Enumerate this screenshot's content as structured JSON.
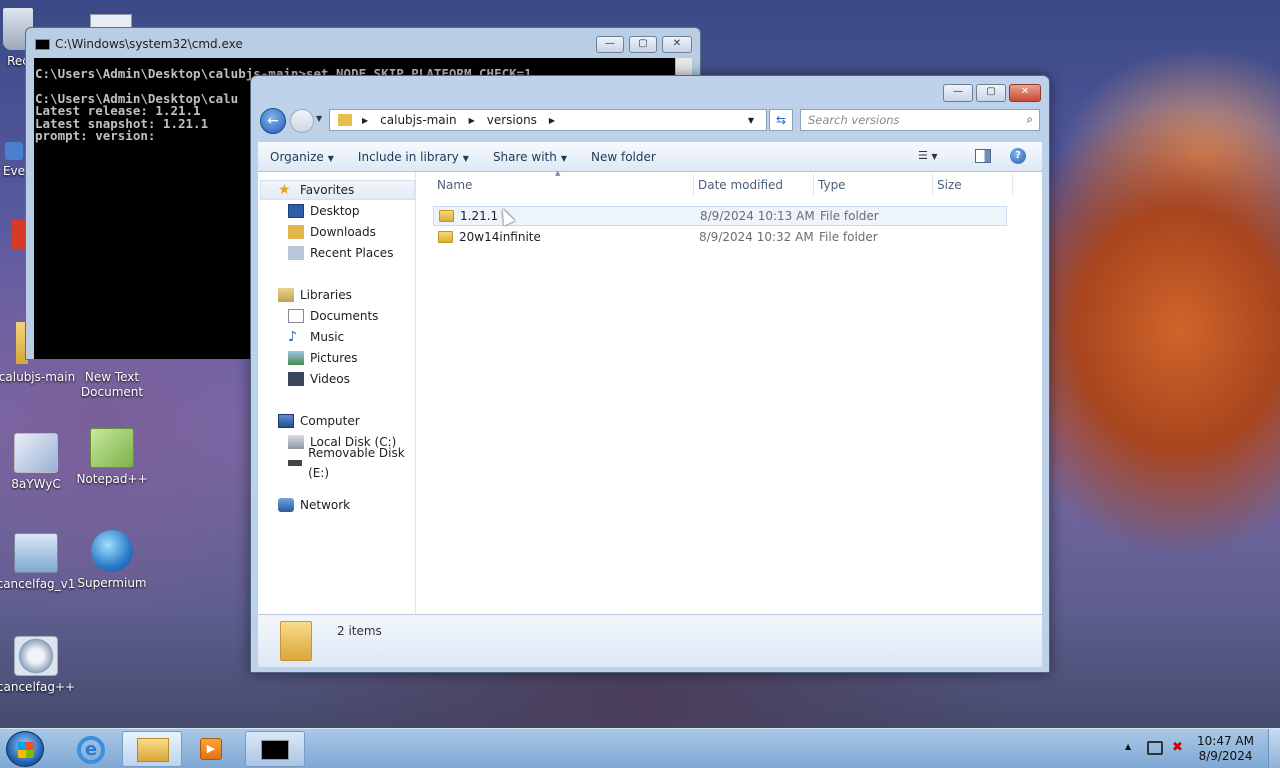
{
  "desktop": {
    "icons": [
      {
        "label": "Rec"
      },
      {
        "label": "Eve"
      },
      {
        "label": "calubjs-main"
      },
      {
        "label": "New Text Document"
      },
      {
        "label": "8aYWyC"
      },
      {
        "label": "Notepad++"
      },
      {
        "label": "cancelfag_v1"
      },
      {
        "label": "Supermium"
      },
      {
        "label": "cancelfag++"
      }
    ]
  },
  "cmd": {
    "title": "C:\\Windows\\system32\\cmd.exe",
    "lines": [
      "C:\\Users\\Admin\\Desktop\\calubjs-main>set NODE_SKIP_PLATFORM_CHECK=1",
      "",
      "C:\\Users\\Admin\\Desktop\\calu",
      "Latest release: 1.21.1",
      "Latest snapshot: 1.21.1",
      "prompt: version:"
    ],
    "minimize": "—",
    "restore": "▢",
    "close": "✕"
  },
  "explorer": {
    "breadcrumb": [
      "calubjs-main",
      "versions"
    ],
    "search_placeholder": "Search versions",
    "toolbar": {
      "organize": "Organize",
      "include": "Include in library",
      "share": "Share with",
      "new_folder": "New folder"
    },
    "nav": {
      "favorites": "Favorites",
      "desktop": "Desktop",
      "downloads": "Downloads",
      "recent": "Recent Places",
      "libraries": "Libraries",
      "documents": "Documents",
      "music": "Music",
      "pictures": "Pictures",
      "videos": "Videos",
      "computer": "Computer",
      "local_disk": "Local Disk (C:)",
      "removable": "Removable Disk (E:)",
      "network": "Network"
    },
    "columns": [
      "Name",
      "Date modified",
      "Type",
      "Size"
    ],
    "files": [
      {
        "name": "1.21.1",
        "date": "8/9/2024 10:13 AM",
        "type": "File folder",
        "size": ""
      },
      {
        "name": "20w14infinite",
        "date": "8/9/2024 10:32 AM",
        "type": "File folder",
        "size": ""
      }
    ],
    "status": "2 items"
  },
  "taskbar": {
    "time": "10:47 AM",
    "date": "8/9/2024",
    "show_hidden": "▲"
  }
}
